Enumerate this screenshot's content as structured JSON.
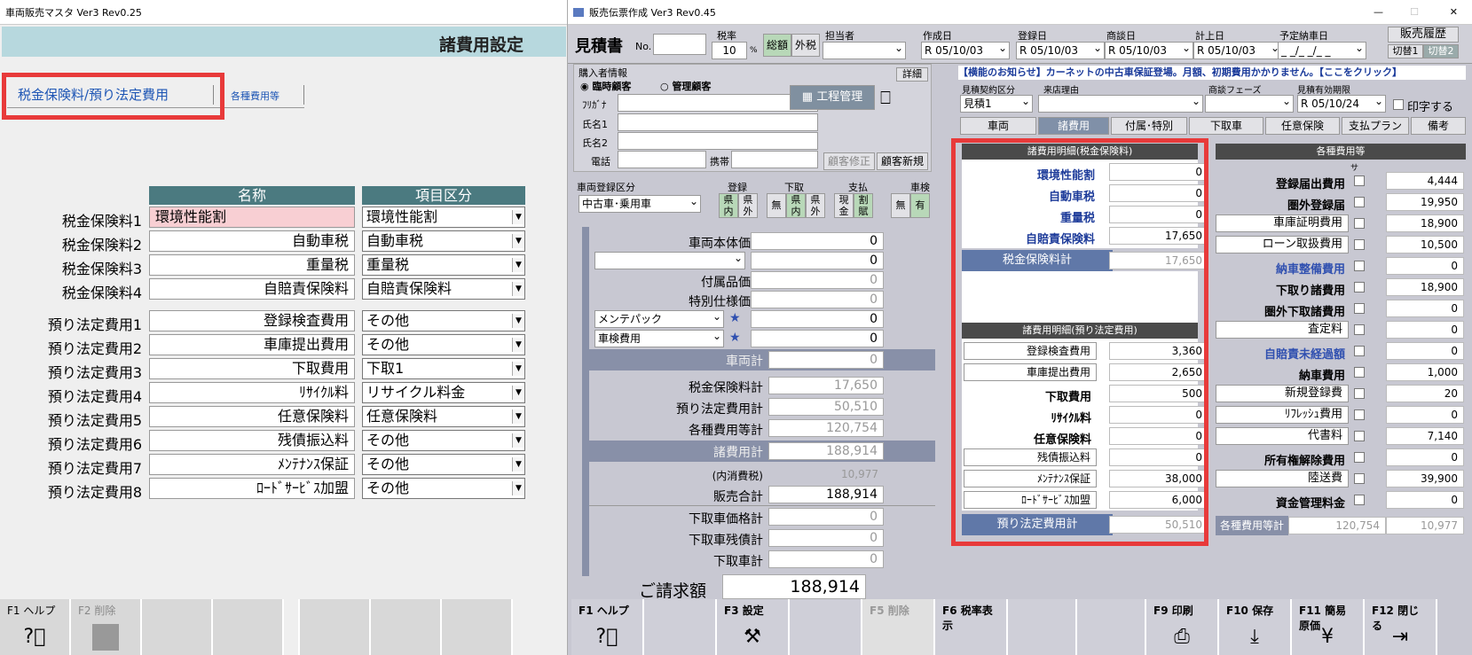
{
  "left": {
    "title": "車両販売マスタ Ver3 Rev0.25",
    "header": "諸費用設定",
    "tabs": [
      "税金保険料/預り法定費用",
      "各種費用等"
    ],
    "col_name": "名称",
    "col_kubun": "項目区分",
    "rows": [
      {
        "label": "税金保険料1",
        "name": "環境性能割",
        "kubun": "環境性能割"
      },
      {
        "label": "税金保険料2",
        "name": "自動車税",
        "kubun": "自動車税"
      },
      {
        "label": "税金保険料3",
        "name": "重量税",
        "kubun": "重量税"
      },
      {
        "label": "税金保険料4",
        "name": "自賠責保険料",
        "kubun": "自賠責保険料"
      },
      {
        "label": "預り法定費用1",
        "name": "登録検査費用",
        "kubun": "その他"
      },
      {
        "label": "預り法定費用2",
        "name": "車庫提出費用",
        "kubun": "その他"
      },
      {
        "label": "預り法定費用3",
        "name": "下取費用",
        "kubun": "下取1"
      },
      {
        "label": "預り法定費用4",
        "name": "ﾘｻｲｸﾙ料",
        "kubun": "リサイクル料金"
      },
      {
        "label": "預り法定費用5",
        "name": "任意保険料",
        "kubun": "任意保険料"
      },
      {
        "label": "預り法定費用6",
        "name": "残債振込料",
        "kubun": "その他"
      },
      {
        "label": "預り法定費用7",
        "name": "ﾒﾝﾃﾅﾝｽ保証",
        "kubun": "その他"
      },
      {
        "label": "預り法定費用8",
        "name": "ﾛｰﾄﾞｻｰﾋﾞｽ加盟",
        "kubun": "その他"
      }
    ],
    "fkeys": [
      "F1 ヘルプ",
      "F2 削除"
    ]
  },
  "right": {
    "title": "販売伝票作成 Ver3 Rev0.45",
    "doc_type": "見積書",
    "no_label": "No.",
    "tax_label": "税率",
    "tax_value": "10",
    "tax_unit": "%",
    "tax_btns": [
      "総額",
      "外税"
    ],
    "tanto": "担当者",
    "dates": [
      {
        "label": "作成日",
        "value": "R 05/10/03"
      },
      {
        "label": "登録日",
        "value": "R 05/10/03"
      },
      {
        "label": "商談日",
        "value": "R 05/10/03"
      },
      {
        "label": "計上日",
        "value": "R 05/10/03"
      },
      {
        "label": "予定納車日",
        "value": "_ _/_ _/_ _"
      }
    ],
    "btn_history": "販売履歴",
    "btn_kiri1": "切替1",
    "btn_kiri2": "切替2",
    "buyer_label": "購入者情報",
    "detail_btn": "詳細",
    "radio1": "臨時顧客",
    "radio2": "管理顧客",
    "furigana": "ﾌﾘｶﾞﾅ",
    "name1": "氏名1",
    "name2": "氏名2",
    "tel": "電話",
    "mobile": "携帯",
    "koutei": "工程管理",
    "btn_cust_edit": "顧客修正",
    "btn_cust_new": "顧客新規",
    "notice": "【横能のお知らせ】カーネットの中古車保証登場。月額、初期費用かかりません。【ここをクリック】",
    "contract_label": "見積契約区分",
    "contract_value": "見積1",
    "visit_label": "来店理由",
    "phase_label": "商談フェーズ",
    "expiry_label": "見積有効期限",
    "expiry_value": "R 05/10/24",
    "print_label": "印字する",
    "subtabs": [
      "車両",
      "諸費用",
      "付属･特別",
      "下取車",
      "任意保険",
      "支払プラン",
      "備考"
    ],
    "reg_kubun_label": "車両登録区分",
    "reg_kubun_value": "中古車･乗用車",
    "touroku": "登録",
    "kennai": "県内",
    "kengai": "県外",
    "shitadori": "下取",
    "nashi": "無",
    "shiharai": "支払",
    "genkin": "現金",
    "kappu": "割賦",
    "shaken": "車検",
    "ari": "有",
    "prices": [
      {
        "label": "車両本体価格",
        "value": "0"
      },
      {
        "label": "",
        "value": "0"
      },
      {
        "label": "付属品価格",
        "value": "0"
      },
      {
        "label": "特別仕様価格",
        "value": "0"
      },
      {
        "label": "メンテパック",
        "value": "0"
      },
      {
        "label": "車検費用",
        "value": "0"
      }
    ],
    "sharyo_kei_label": "車両計",
    "sharyo_kei": "0",
    "zeikin_kei_label": "税金保険料計",
    "zeikin_kei": "17,650",
    "azukari_kei_label": "預り法定費用計",
    "azukari_kei": "50,510",
    "kakushu_kei_label": "各種費用等計",
    "kakushu_kei": "120,754",
    "shohiyo_kei_label": "諸費用計",
    "shohiyo_kei": "188,914",
    "uchi_label": "(内消費税)",
    "uchi_value": "10,977",
    "hanbai_label": "販売合計",
    "hanbai_value": "188,914",
    "shitadori_price_label": "下取車価格計",
    "shitadori_price": "0",
    "shitadori_zan_label": "下取車残債計",
    "shitadori_zan": "0",
    "shitadori_kei_label": "下取車計",
    "shitadori_kei": "0",
    "seikyu_label": "ご請求額",
    "seikyu_value": "188,914",
    "zei_header": "諸費用明細(税金保険料)",
    "zei_rows": [
      {
        "label": "環境性能割",
        "value": "0"
      },
      {
        "label": "自動車税",
        "value": "0"
      },
      {
        "label": "重量税",
        "value": "0"
      },
      {
        "label": "自賠責保険料",
        "value": "17,650"
      }
    ],
    "zei_total_label": "税金保険料計",
    "zei_total": "17,650",
    "az_header": "諸費用明細(預り法定費用)",
    "az_rows": [
      {
        "label": "登録検査費用",
        "value": "3,360"
      },
      {
        "label": "車庫提出費用",
        "value": "2,650"
      },
      {
        "label": "下取費用",
        "value": "500"
      },
      {
        "label": "ﾘｻｲｸﾙ料",
        "value": "0"
      },
      {
        "label": "任意保険料",
        "value": "0"
      },
      {
        "label": "残債振込料",
        "value": "0"
      },
      {
        "label": "ﾒﾝﾃﾅﾝｽ保証",
        "value": "38,000"
      },
      {
        "label": "ﾛｰﾄﾞｻｰﾋﾞｽ加盟",
        "value": "6,000"
      }
    ],
    "az_total_label": "預り法定費用計",
    "az_total": "50,510",
    "kakushu_header": "各種費用等",
    "sa": "サ",
    "kakushu_rows": [
      {
        "label": "登録届出費用",
        "value": "4,444"
      },
      {
        "label": "圏外登録届",
        "value": "19,950"
      },
      {
        "label": "車庫証明費用",
        "value": "18,900"
      },
      {
        "label": "ローン取扱費用",
        "value": "10,500"
      },
      {
        "label": "納車整備費用",
        "value": "0"
      },
      {
        "label": "下取り諸費用",
        "value": "18,900"
      },
      {
        "label": "圏外下取諸費用",
        "value": "0"
      },
      {
        "label": "査定料",
        "value": "0"
      },
      {
        "label": "自賠責未経過額",
        "value": "0"
      },
      {
        "label": "納車費用",
        "value": "1,000"
      },
      {
        "label": "新規登録費",
        "value": "20"
      },
      {
        "label": "ﾘﾌﾚｯｼｭ費用",
        "value": "0"
      },
      {
        "label": "代書料",
        "value": "7,140"
      },
      {
        "label": "所有権解除費用",
        "value": "0"
      },
      {
        "label": "陸送費",
        "value": "39,900"
      },
      {
        "label": "資金管理料金",
        "value": "0"
      }
    ],
    "kakushu_total_label": "各種費用等計",
    "kakushu_total": "120,754",
    "kakushu_tax": "10,977",
    "fkeys": [
      "F1 ヘルプ",
      "",
      "F3 設定",
      "",
      "F5 削除",
      "F6 税率表示",
      "",
      "",
      "F9 印刷",
      "F10 保存",
      "F11 簡易原価",
      "F12 閉じる"
    ]
  }
}
